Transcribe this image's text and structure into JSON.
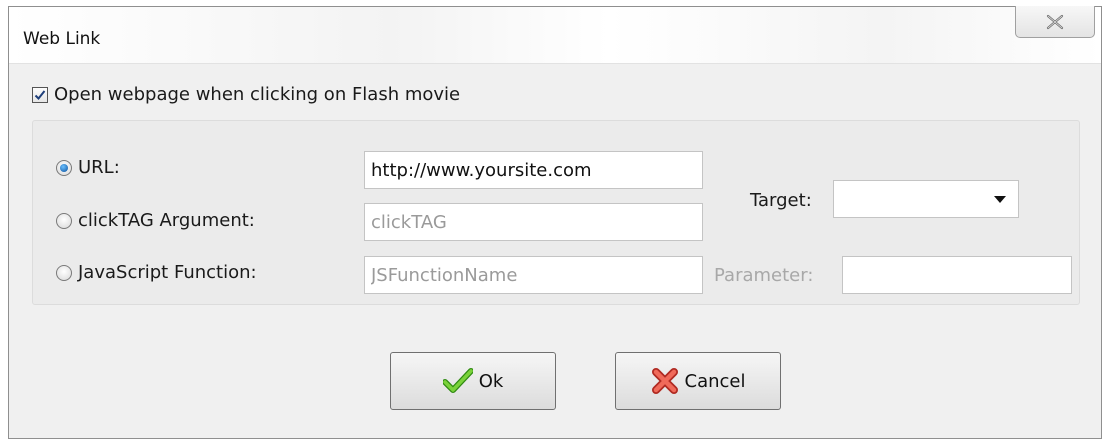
{
  "dialog": {
    "title": "Web Link",
    "close_label": "close"
  },
  "open_webpage": {
    "label": "Open webpage when clicking on Flash movie",
    "checked": true
  },
  "options": {
    "url": {
      "label": "URL:",
      "value": "http://www.yoursite.com",
      "selected": true
    },
    "clicktag": {
      "label": "clickTAG Argument:",
      "value": "clickTAG",
      "selected": false
    },
    "javascript": {
      "label": "JavaScript Function:",
      "value": "JSFunctionName",
      "selected": false
    }
  },
  "target": {
    "label": "Target:",
    "value": ""
  },
  "parameter": {
    "label": "Parameter:",
    "value": ""
  },
  "buttons": {
    "ok": "Ok",
    "cancel": "Cancel"
  },
  "icons": {
    "close": "close-x-icon",
    "ok": "green-checkmark-icon",
    "cancel": "red-x-icon"
  },
  "colors": {
    "dialog_bg": "#f0f0f0",
    "group_bg": "#ebebeb",
    "radio_selected": "#0a4f9c",
    "ok_icon": "#55b21f",
    "cancel_icon": "#e0443b"
  }
}
